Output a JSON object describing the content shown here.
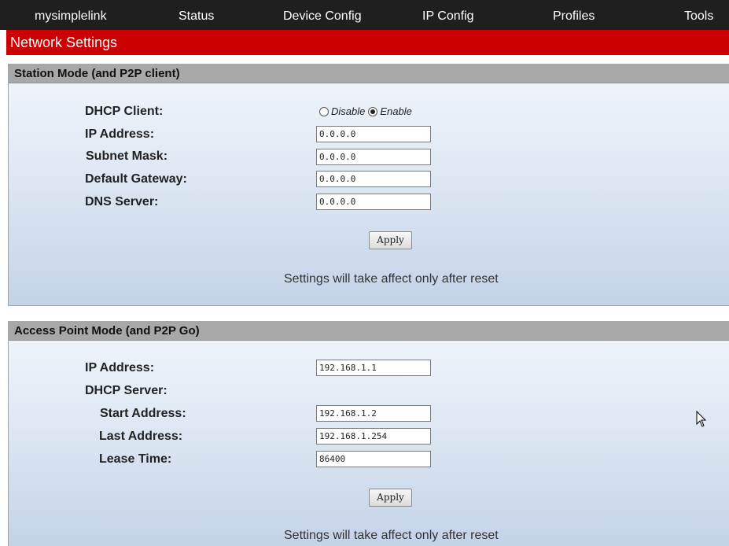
{
  "nav": {
    "items": [
      "mysimplelink",
      "Status",
      "Device Config",
      "IP Config",
      "Profiles",
      "Tools"
    ]
  },
  "page_title": "Network Settings",
  "station": {
    "header": "Station Mode (and P2P client)",
    "dhcp_label": "DHCP Client:",
    "dhcp_options": [
      "Disable",
      "Enable"
    ],
    "dhcp_selected": "Enable",
    "ip_label": "IP Address:",
    "ip_value": "0.0.0.0",
    "subnet_label": "Subnet Mask:",
    "subnet_value": "0.0.0.0",
    "gateway_label": "Default Gateway:",
    "gateway_value": "0.0.0.0",
    "dns_label": "DNS Server:",
    "dns_value": "0.0.0.0",
    "apply_label": "Apply",
    "note": "Settings will take affect only after reset"
  },
  "ap": {
    "header": "Access Point Mode (and P2P Go)",
    "ip_label": "IP Address:",
    "ip_value": "192.168.1.1",
    "dhcp_server_label": "DHCP Server:",
    "start_label": "Start Address:",
    "start_value": "192.168.1.2",
    "last_label": "Last Address:",
    "last_value": "192.168.1.254",
    "lease_label": "Lease Time:",
    "lease_value": "86400",
    "apply_label": "Apply",
    "note": "Settings will take affect only after reset"
  },
  "colors": {
    "nav_bg": "#1f1f1f",
    "title_bg": "#cc0000",
    "section_header_bg": "#a8a8a8"
  },
  "icons": [
    "mouse-cursor-icon"
  ]
}
